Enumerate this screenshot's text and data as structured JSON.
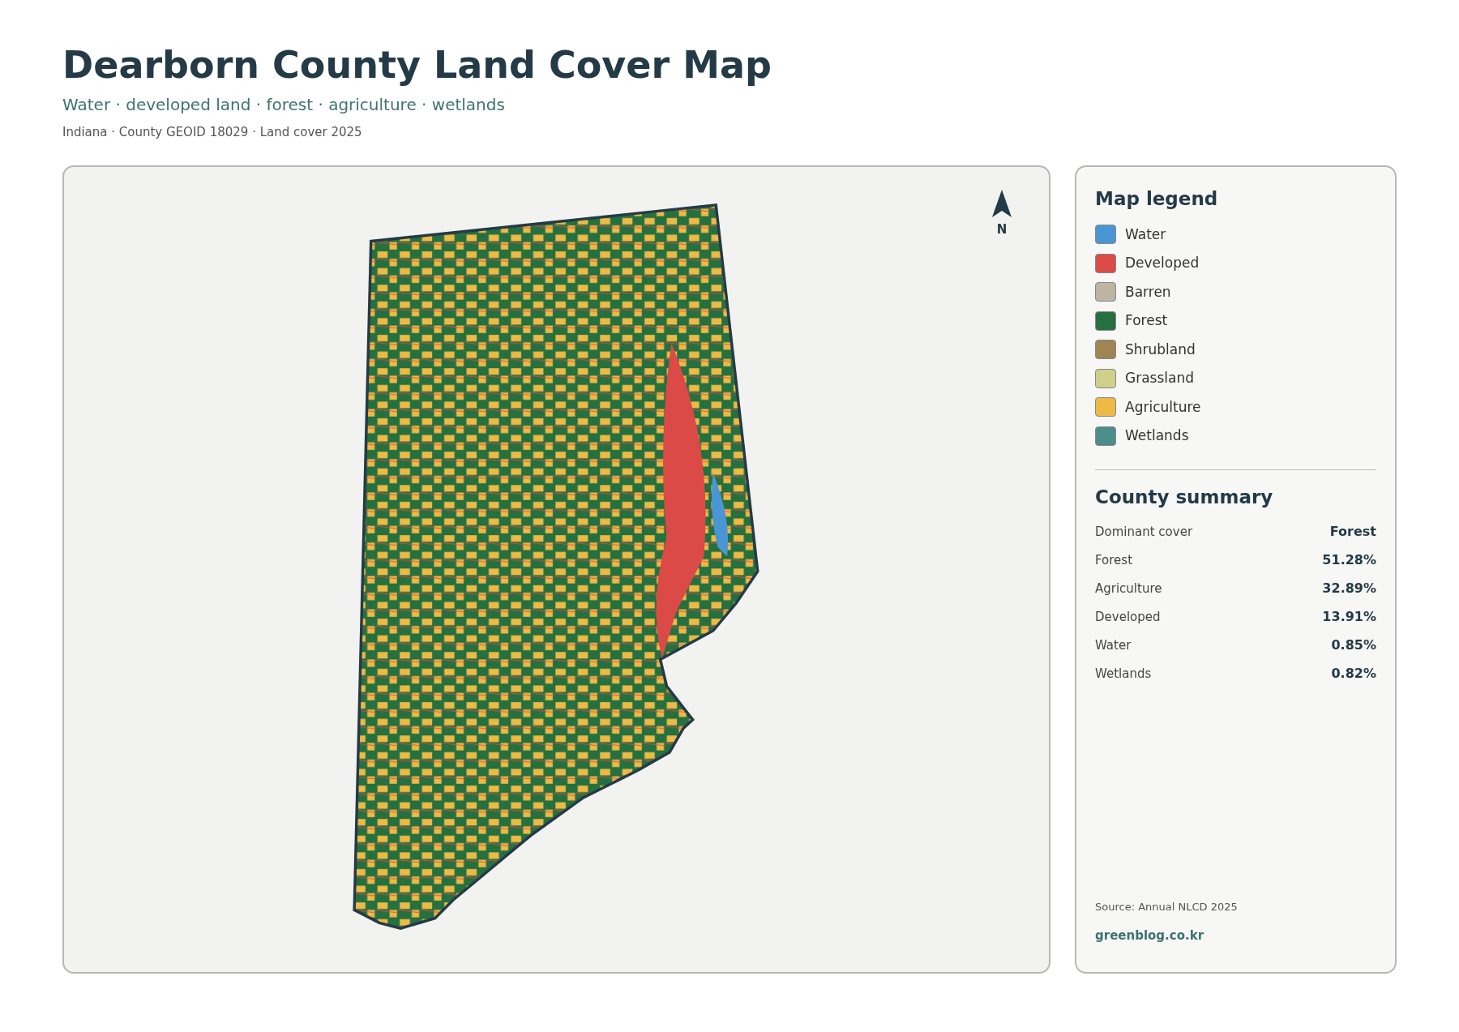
{
  "header": {
    "title": "Dearborn County Land Cover Map",
    "subtitle": "Water · developed land · forest · agriculture · wetlands",
    "meta": "Indiana · County GEOID 18029 · Land cover 2025"
  },
  "map": {
    "north_label": "N"
  },
  "legend": {
    "title": "Map legend",
    "items": [
      {
        "label": "Water",
        "color": "#4a96d4"
      },
      {
        "label": "Developed",
        "color": "#db4a47"
      },
      {
        "label": "Barren",
        "color": "#bdb4a2"
      },
      {
        "label": "Forest",
        "color": "#26703f"
      },
      {
        "label": "Shrubland",
        "color": "#a08552"
      },
      {
        "label": "Grassland",
        "color": "#cfd08a"
      },
      {
        "label": "Agriculture",
        "color": "#edba45"
      },
      {
        "label": "Wetlands",
        "color": "#4b8e8a"
      }
    ]
  },
  "summary": {
    "title": "County summary",
    "rows": [
      {
        "label": "Dominant cover",
        "value": "Forest"
      },
      {
        "label": "Forest",
        "value": "51.28%"
      },
      {
        "label": "Agriculture",
        "value": "32.89%"
      },
      {
        "label": "Developed",
        "value": "13.91%"
      },
      {
        "label": "Water",
        "value": "0.85%"
      },
      {
        "label": "Wetlands",
        "value": "0.82%"
      }
    ]
  },
  "footer": {
    "source": "Source: Annual NLCD 2025",
    "link": "greenblog.co.kr"
  }
}
